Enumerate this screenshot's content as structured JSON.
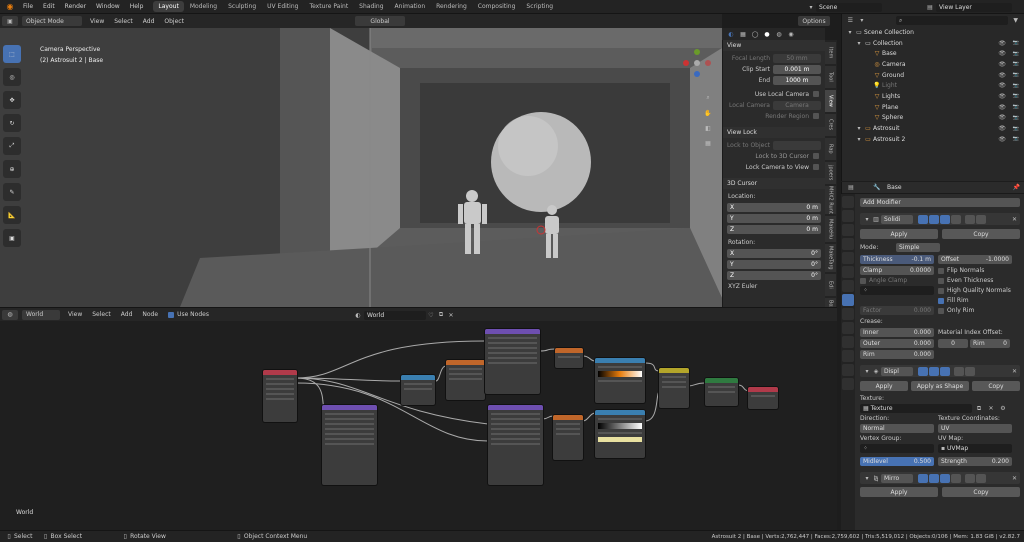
{
  "topbar": {
    "menus": [
      "File",
      "Edit",
      "Render",
      "Window",
      "Help"
    ],
    "workspaces": [
      "Layout",
      "Modeling",
      "Sculpting",
      "UV Editing",
      "Texture Paint",
      "Shading",
      "Animation",
      "Rendering",
      "Compositing",
      "Scripting"
    ],
    "active_workspace": "Layout",
    "scene": "Scene",
    "view_layer": "View Layer"
  },
  "viewport_header": {
    "mode": "Object Mode",
    "menus": [
      "View",
      "Select",
      "Add",
      "Object"
    ],
    "orientation": "Global",
    "options": "Options"
  },
  "viewport": {
    "perspective": "Camera Perspective",
    "object_info": "(2) Astrosuit 2 | Base"
  },
  "npanel": {
    "view_title": "View",
    "focal_length_label": "Focal Length",
    "focal_length": "50 mm",
    "clip_start_label": "Clip Start",
    "clip_start": "0.001 m",
    "end_label": "End",
    "end": "1000 m",
    "use_local_camera": "Use Local Camera",
    "local_camera_label": "Local Camera",
    "local_camera": "Camera",
    "render_region": "Render Region",
    "view_lock_title": "View Lock",
    "lock_to_object": "Lock to Object",
    "lock_to_3d_cursor": "Lock to 3D Cursor",
    "lock_camera_to_view": "Lock Camera to View",
    "cursor_title": "3D Cursor",
    "location_label": "Location:",
    "x": "X",
    "y": "Y",
    "z": "Z",
    "loc_x": "0 m",
    "loc_y": "0 m",
    "loc_z": "0 m",
    "rotation_label": "Rotation:",
    "rot_x": "0°",
    "rot_y": "0°",
    "rot_z": "0°",
    "rotation_mode": "XYZ Euler"
  },
  "ntabs": [
    "Item",
    "Tool",
    "View",
    "Cres",
    "Rap",
    "jpoers",
    "MHX2 Runt",
    "MakeHu",
    "MakeTarg",
    "Edi",
    "BoxCut"
  ],
  "node_header": {
    "type": "World",
    "menus": [
      "View",
      "Select",
      "Add",
      "Node"
    ],
    "use_nodes": "Use Nodes",
    "world_name": "World"
  },
  "node_editor": {
    "context_label": "World"
  },
  "status": {
    "select": "Select",
    "box_select": "Box Select",
    "rotate_view": "Rotate View",
    "context_menu": "Object Context Menu",
    "stats": "Astrosuit 2 | Base | Verts:2,762,447 | Faces:2,759,602 | Tris:5,519,012 | Objects:0/106 | Mem: 1.83 GiB | v2.82.7"
  },
  "outliner": {
    "search_placeholder": "",
    "items": [
      {
        "label": "Scene Collection",
        "depth": 0
      },
      {
        "label": "Collection",
        "depth": 1
      },
      {
        "label": "Base",
        "depth": 2
      },
      {
        "label": "Camera",
        "depth": 2
      },
      {
        "label": "Ground",
        "depth": 2
      },
      {
        "label": "Light",
        "depth": 2
      },
      {
        "label": "Lights",
        "depth": 2
      },
      {
        "label": "Plane",
        "depth": 2
      },
      {
        "label": "Sphere",
        "depth": 2
      },
      {
        "label": "Astrosuit",
        "depth": 1
      },
      {
        "label": "Astrosuit 2",
        "depth": 1
      }
    ]
  },
  "properties": {
    "object_name": "Base",
    "add_modifier": "Add Modifier",
    "mod1_name": "Solidi",
    "apply": "Apply",
    "copy": "Copy",
    "mode_label": "Mode:",
    "mode_value": "Simple",
    "thickness_label": "Thickness",
    "thickness": "-0.1 m",
    "offset_label": "Offset",
    "offset": "-1.0000",
    "clamp_label": "Clamp",
    "clamp": "0.0000",
    "angle_clamp": "Angle Clamp",
    "flip_normals": "Flip Normals",
    "even_thickness": "Even Thickness",
    "high_quality_normals": "High Quality Normals",
    "fill_rim": "Fill Rim",
    "only_rim": "Only Rim",
    "factor_label": "Factor",
    "factor": "0.000",
    "crease_label": "Crease:",
    "inner_label": "Inner",
    "inner": "0.000",
    "outer_label": "Outer",
    "outer": "0.000",
    "rim_label": "Rim",
    "rim": "0.000",
    "material_index_offset": "Material Index Offset:",
    "mat_offset": "0",
    "mat_rim_label": "Rim",
    "mat_rim": "0",
    "mod2_name": "Displ",
    "apply_as_shape": "Apply as Shape",
    "texture_label": "Texture:",
    "texture_value": "Texture",
    "direction_label": "Direction:",
    "direction": "Normal",
    "tex_coords_label": "Texture Coordinates:",
    "tex_coords": "UV",
    "vertex_group_label": "Vertex Group:",
    "uv_map_label": "UV Map:",
    "uv_map": "UVMap",
    "midlevel_label": "Midlevel",
    "midlevel": "0.500",
    "strength_label": "Strength",
    "strength": "0.200",
    "mod3_name": "Mirro"
  },
  "colors": {
    "accent": "#4772b3",
    "node_purple": "#6e4fb0",
    "node_blue": "#3a7fb0",
    "node_orange": "#c0662a",
    "node_yellow": "#b3a52a",
    "node_green": "#2f7a40",
    "node_red": "#b03a4a",
    "node_input": "#b03a4a"
  }
}
